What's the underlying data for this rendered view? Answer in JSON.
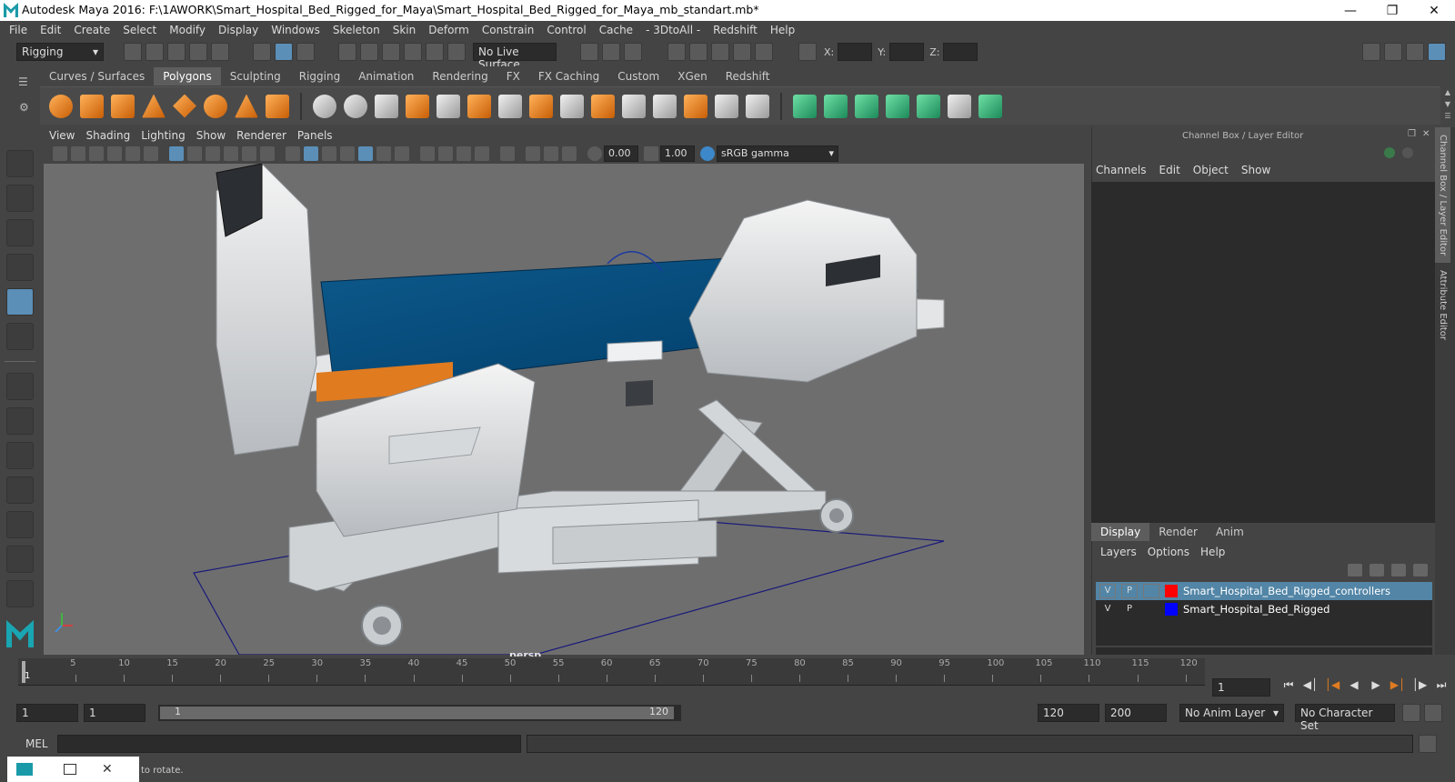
{
  "window": {
    "title": "Autodesk Maya 2016: F:\\1AWORK\\Smart_Hospital_Bed_Rigged_for_Maya\\Smart_Hospital_Bed_Rigged_for_Maya_mb_standart.mb*"
  },
  "menubar": [
    "File",
    "Edit",
    "Create",
    "Select",
    "Modify",
    "Display",
    "Windows",
    "Skeleton",
    "Skin",
    "Deform",
    "Constrain",
    "Control",
    "Cache",
    "- 3DtoAll -",
    "Redshift",
    "Help"
  ],
  "status": {
    "menuset": "Rigging",
    "live_surface": "No Live Surface",
    "x_label": "X:",
    "y_label": "Y:",
    "z_label": "Z:"
  },
  "shelf_tabs": [
    "Curves / Surfaces",
    "Polygons",
    "Sculpting",
    "Rigging",
    "Animation",
    "Rendering",
    "FX",
    "FX Caching",
    "Custom",
    "XGen",
    "Redshift"
  ],
  "shelf_active": "Polygons",
  "viewport": {
    "menu": [
      "View",
      "Shading",
      "Lighting",
      "Show",
      "Renderer",
      "Panels"
    ],
    "exposure": "0.00",
    "gamma": "1.00",
    "colorspace": "sRGB gamma",
    "camera": "persp"
  },
  "channel_box": {
    "title": "Channel Box / Layer Editor",
    "menu": [
      "Channels",
      "Edit",
      "Object",
      "Show"
    ],
    "tabs": [
      "Display",
      "Render",
      "Anim"
    ],
    "layer_menu": [
      "Layers",
      "Options",
      "Help"
    ],
    "layers": [
      {
        "v": "V",
        "p": "P",
        "name": "Smart_Hospital_Bed_Rigged_controllers",
        "color": "#ff0000",
        "selected": true
      },
      {
        "v": "V",
        "p": "P",
        "name": "Smart_Hospital_Bed_Rigged",
        "color": "#0000ff",
        "selected": false
      }
    ],
    "side_tabs": [
      "Channel Box / Layer Editor",
      "Attribute Editor"
    ]
  },
  "timeline": {
    "ticks": [
      "5",
      "10",
      "15",
      "20",
      "25",
      "30",
      "35",
      "40",
      "45",
      "50",
      "55",
      "60",
      "65",
      "70",
      "75",
      "80",
      "85",
      "90",
      "95",
      "100",
      "105",
      "110",
      "115",
      "120"
    ],
    "start_marker": "1",
    "current_frame": "1"
  },
  "range": {
    "start": "1",
    "playback_start": "1",
    "slider_start": "1",
    "slider_end": "120",
    "playback_end": "120",
    "end": "200",
    "anim_layer": "No Anim Layer",
    "char_set": "No Character Set"
  },
  "mel": {
    "label": "MEL"
  },
  "help": {
    "text": "to rotate."
  }
}
